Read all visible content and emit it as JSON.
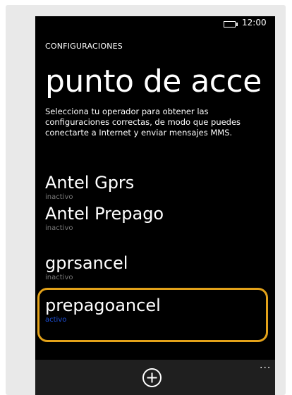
{
  "status_bar": {
    "time": "12:00"
  },
  "header": {
    "app_title": "CONFIGURACIONES",
    "page_title": "punto de acce"
  },
  "description": "Selecciona tu operador para obtener las configuraciones correctas, de modo que puedes conectarte a Internet y enviar mensajes MMS.",
  "access_points": [
    {
      "name": "Antel Gprs",
      "status": "inactivo"
    },
    {
      "name": "Antel Prepago",
      "status": "inactivo"
    },
    {
      "name": "gprsancel",
      "status": "inactivo"
    },
    {
      "name": "prepagoancel",
      "status": "activo"
    }
  ],
  "app_bar": {
    "add_icon": "plus-circle-icon",
    "more": "..."
  },
  "colors": {
    "accent": "#1d4fd6",
    "highlight": "#e3a21a",
    "inactive": "#7a7a7a"
  }
}
